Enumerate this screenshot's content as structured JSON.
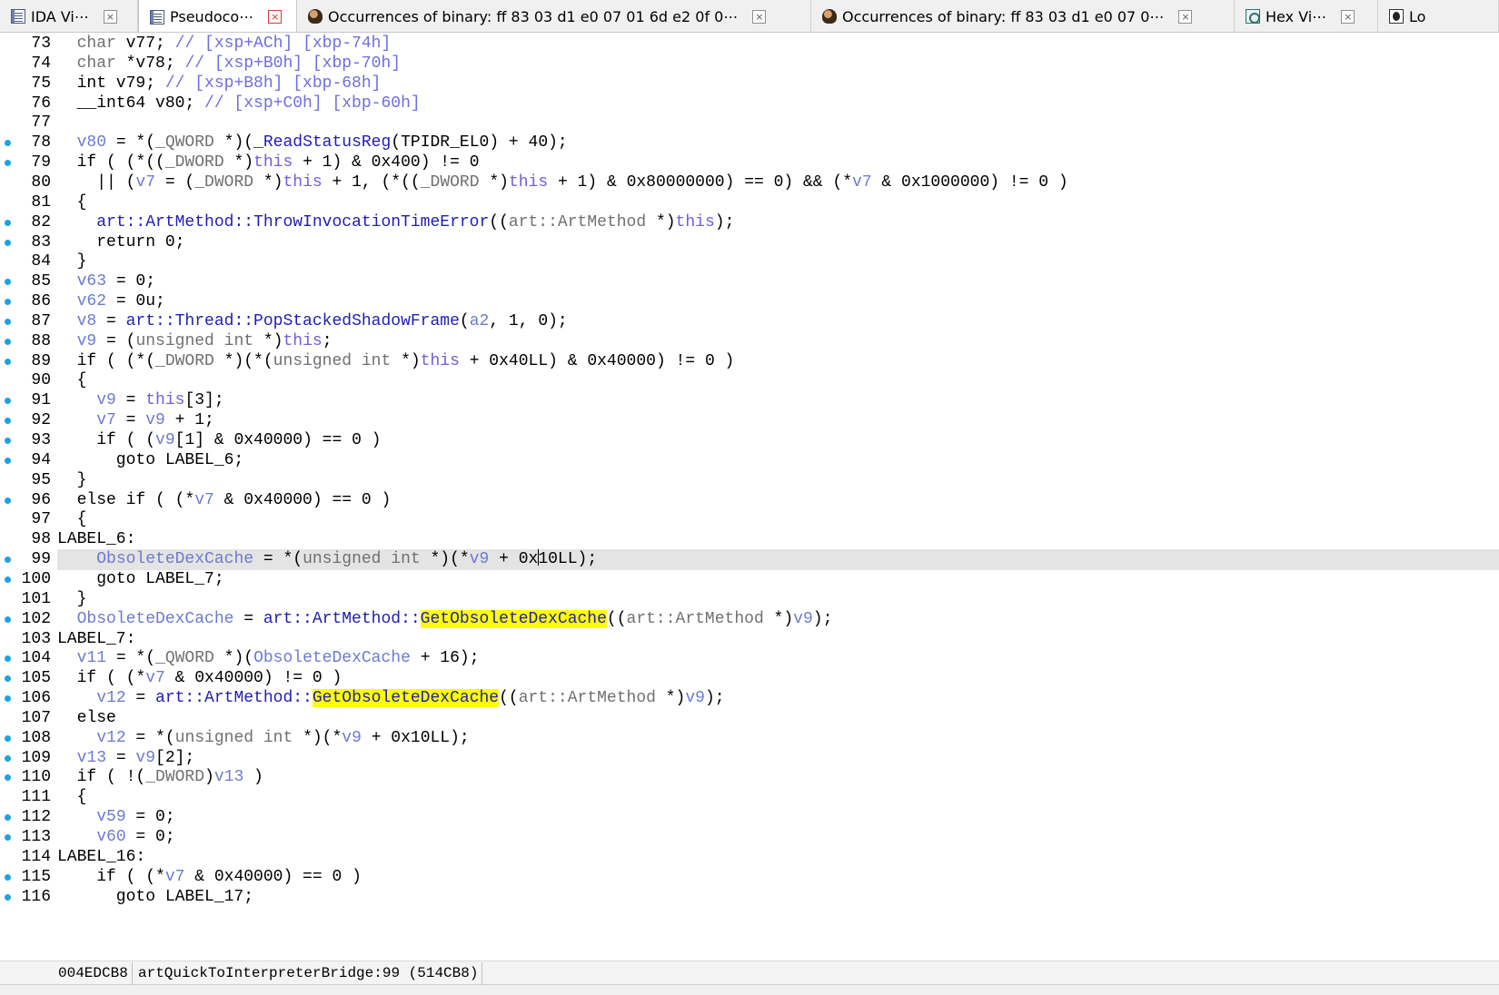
{
  "tabs": [
    {
      "label": "IDA Vi⋯",
      "icon": "disassembly-view-icon",
      "active": false
    },
    {
      "label": "Pseudoco⋯",
      "icon": "pseudocode-view-icon",
      "active": true
    },
    {
      "label": "Occurrences of binary: ff 83 03 d1 e0 07 01 6d e2 0f 0⋯",
      "icon": "occurrences-icon",
      "active": false
    },
    {
      "label": "Occurrences of binary: ff 83 03 d1 e0 07 0⋯",
      "icon": "occurrences-icon",
      "active": false
    },
    {
      "label": "Hex Vi⋯",
      "icon": "hex-view-icon",
      "active": false
    },
    {
      "label": "Lo",
      "icon": "log-icon",
      "active": false
    }
  ],
  "tab_close_glyph": "×",
  "colors": {
    "bullet": "#1aa3e0",
    "highlight": "#ffff00",
    "current_line": "#e4e4e4",
    "comment": "#6e6ee0",
    "variable": "#6b7bd0",
    "function": "#2020b0"
  },
  "lines": [
    {
      "n": "73",
      "bp": false,
      "tokens": [
        [
          "",
          "  "
        ],
        [
          "type",
          "char"
        ],
        [
          "",
          " v77; "
        ],
        [
          "comment",
          "// [xsp+ACh] [xbp-74h]"
        ]
      ]
    },
    {
      "n": "74",
      "bp": false,
      "tokens": [
        [
          "",
          "  "
        ],
        [
          "type",
          "char"
        ],
        [
          "",
          " *v78; "
        ],
        [
          "comment",
          "// [xsp+B0h] [xbp-70h]"
        ]
      ]
    },
    {
      "n": "75",
      "bp": false,
      "tokens": [
        [
          "",
          "  int v79; "
        ],
        [
          "comment",
          "// [xsp+B8h] [xbp-68h]"
        ]
      ]
    },
    {
      "n": "76",
      "bp": false,
      "tokens": [
        [
          "",
          "  __int64 v80; "
        ],
        [
          "comment",
          "// [xsp+C0h] [xbp-60h]"
        ]
      ]
    },
    {
      "n": "77",
      "bp": false,
      "tokens": []
    },
    {
      "n": "78",
      "bp": true,
      "tokens": [
        [
          "",
          "  "
        ],
        [
          "var",
          "v80"
        ],
        [
          "",
          " = *("
        ],
        [
          "type",
          "_QWORD"
        ],
        [
          "",
          " *)("
        ],
        [
          "func",
          "_ReadStatusReg"
        ],
        [
          "",
          "(TPIDR_EL0) + 40);"
        ]
      ]
    },
    {
      "n": "79",
      "bp": true,
      "tokens": [
        [
          "",
          "  if ( (*(("
        ],
        [
          "type",
          "_DWORD"
        ],
        [
          "",
          " *)"
        ],
        [
          "this",
          "this"
        ],
        [
          "",
          " + 1) & 0x400) != 0"
        ]
      ]
    },
    {
      "n": "80",
      "bp": false,
      "tokens": [
        [
          "",
          "    || ("
        ],
        [
          "var",
          "v7"
        ],
        [
          "",
          " = ("
        ],
        [
          "type",
          "_DWORD"
        ],
        [
          "",
          " *)"
        ],
        [
          "this",
          "this"
        ],
        [
          "",
          " + 1, (*(("
        ],
        [
          "type",
          "_DWORD"
        ],
        [
          "",
          " *)"
        ],
        [
          "this",
          "this"
        ],
        [
          "",
          " + 1) & 0x80000000) == 0) && (*"
        ],
        [
          "var",
          "v7"
        ],
        [
          "",
          " & 0x1000000) != 0 )"
        ]
      ]
    },
    {
      "n": "81",
      "bp": false,
      "tokens": [
        [
          "",
          "  {"
        ]
      ]
    },
    {
      "n": "82",
      "bp": true,
      "tokens": [
        [
          "",
          "    "
        ],
        [
          "func",
          "art::ArtMethod::ThrowInvocationTimeError"
        ],
        [
          "",
          "(("
        ],
        [
          "type",
          "art::ArtMethod"
        ],
        [
          "",
          " *)"
        ],
        [
          "this",
          "this"
        ],
        [
          "",
          ");"
        ]
      ]
    },
    {
      "n": "83",
      "bp": true,
      "tokens": [
        [
          "",
          "    return 0;"
        ]
      ]
    },
    {
      "n": "84",
      "bp": false,
      "tokens": [
        [
          "",
          "  }"
        ]
      ]
    },
    {
      "n": "85",
      "bp": true,
      "tokens": [
        [
          "",
          "  "
        ],
        [
          "var",
          "v63"
        ],
        [
          "",
          " = 0;"
        ]
      ]
    },
    {
      "n": "86",
      "bp": true,
      "tokens": [
        [
          "",
          "  "
        ],
        [
          "var",
          "v62"
        ],
        [
          "",
          " = 0u;"
        ]
      ]
    },
    {
      "n": "87",
      "bp": true,
      "tokens": [
        [
          "",
          "  "
        ],
        [
          "var",
          "v8"
        ],
        [
          "",
          " = "
        ],
        [
          "func",
          "art::Thread::PopStackedShadowFrame"
        ],
        [
          "",
          "("
        ],
        [
          "var",
          "a2"
        ],
        [
          "",
          ", 1, 0);"
        ]
      ]
    },
    {
      "n": "88",
      "bp": true,
      "tokens": [
        [
          "",
          "  "
        ],
        [
          "var",
          "v9"
        ],
        [
          "",
          " = ("
        ],
        [
          "type",
          "unsigned int"
        ],
        [
          "",
          " *)"
        ],
        [
          "this",
          "this"
        ],
        [
          "",
          ";"
        ]
      ]
    },
    {
      "n": "89",
      "bp": true,
      "tokens": [
        [
          "",
          "  if ( (*("
        ],
        [
          "type",
          "_DWORD"
        ],
        [
          "",
          " *)(*("
        ],
        [
          "type",
          "unsigned int"
        ],
        [
          "",
          " *)"
        ],
        [
          "this",
          "this"
        ],
        [
          "",
          " + 0x40LL) & 0x40000) != 0 )"
        ]
      ]
    },
    {
      "n": "90",
      "bp": false,
      "tokens": [
        [
          "",
          "  {"
        ]
      ]
    },
    {
      "n": "91",
      "bp": true,
      "tokens": [
        [
          "",
          "    "
        ],
        [
          "var",
          "v9"
        ],
        [
          "",
          " = "
        ],
        [
          "this",
          "this"
        ],
        [
          "",
          "[3];"
        ]
      ]
    },
    {
      "n": "92",
      "bp": true,
      "tokens": [
        [
          "",
          "    "
        ],
        [
          "var",
          "v7"
        ],
        [
          "",
          " = "
        ],
        [
          "var",
          "v9"
        ],
        [
          "",
          " + 1;"
        ]
      ]
    },
    {
      "n": "93",
      "bp": true,
      "tokens": [
        [
          "",
          "    if ( ("
        ],
        [
          "var",
          "v9"
        ],
        [
          "",
          "[1] & 0x40000) == 0 )"
        ]
      ]
    },
    {
      "n": "94",
      "bp": true,
      "tokens": [
        [
          "",
          "      goto LABEL_6;"
        ]
      ]
    },
    {
      "n": "95",
      "bp": false,
      "tokens": [
        [
          "",
          "  }"
        ]
      ]
    },
    {
      "n": "96",
      "bp": true,
      "tokens": [
        [
          "",
          "  else if ( (*"
        ],
        [
          "var",
          "v7"
        ],
        [
          "",
          " & 0x40000) == 0 )"
        ]
      ]
    },
    {
      "n": "97",
      "bp": false,
      "tokens": [
        [
          "",
          "  {"
        ]
      ]
    },
    {
      "n": "98",
      "bp": false,
      "tokens": [
        [
          "",
          "LABEL_6:"
        ]
      ]
    },
    {
      "n": "99",
      "bp": true,
      "current": true,
      "tokens": [
        [
          "",
          "    "
        ],
        [
          "glob",
          "ObsoleteDexCache"
        ],
        [
          "",
          " = *("
        ],
        [
          "type",
          "unsigned int"
        ],
        [
          "",
          " *)(*"
        ],
        [
          "var",
          "v9"
        ],
        [
          "",
          " + 0x"
        ],
        [
          "caret",
          ""
        ],
        [
          "",
          "10LL);"
        ]
      ]
    },
    {
      "n": "100",
      "bp": true,
      "tokens": [
        [
          "",
          "    goto LABEL_7;"
        ]
      ]
    },
    {
      "n": "101",
      "bp": false,
      "tokens": [
        [
          "",
          "  }"
        ]
      ]
    },
    {
      "n": "102",
      "bp": true,
      "tokens": [
        [
          "",
          "  "
        ],
        [
          "glob",
          "ObsoleteDexCache"
        ],
        [
          "",
          " = "
        ],
        [
          "func",
          "art::ArtMethod::"
        ],
        [
          "hl",
          "GetObsoleteDexCache"
        ],
        [
          "",
          "(("
        ],
        [
          "type",
          "art::ArtMethod"
        ],
        [
          "",
          " *)"
        ],
        [
          "var",
          "v9"
        ],
        [
          "",
          ");"
        ]
      ]
    },
    {
      "n": "103",
      "bp": false,
      "tokens": [
        [
          "",
          "LABEL_7:"
        ]
      ]
    },
    {
      "n": "104",
      "bp": true,
      "tokens": [
        [
          "",
          "  "
        ],
        [
          "var",
          "v11"
        ],
        [
          "",
          " = *("
        ],
        [
          "type",
          "_QWORD"
        ],
        [
          "",
          " *)("
        ],
        [
          "glob",
          "ObsoleteDexCache"
        ],
        [
          "",
          " + 16);"
        ]
      ]
    },
    {
      "n": "105",
      "bp": true,
      "tokens": [
        [
          "",
          "  if ( (*"
        ],
        [
          "var",
          "v7"
        ],
        [
          "",
          " & 0x40000) != 0 )"
        ]
      ]
    },
    {
      "n": "106",
      "bp": true,
      "tokens": [
        [
          "",
          "    "
        ],
        [
          "var",
          "v12"
        ],
        [
          "",
          " = "
        ],
        [
          "func",
          "art::ArtMethod::"
        ],
        [
          "hl",
          "GetObsoleteDexCache"
        ],
        [
          "",
          "(("
        ],
        [
          "type",
          "art::ArtMethod"
        ],
        [
          "",
          " *)"
        ],
        [
          "var",
          "v9"
        ],
        [
          "",
          ");"
        ]
      ]
    },
    {
      "n": "107",
      "bp": false,
      "tokens": [
        [
          "",
          "  else"
        ]
      ]
    },
    {
      "n": "108",
      "bp": true,
      "tokens": [
        [
          "",
          "    "
        ],
        [
          "var",
          "v12"
        ],
        [
          "",
          " = *("
        ],
        [
          "type",
          "unsigned int"
        ],
        [
          "",
          " *)(*"
        ],
        [
          "var",
          "v9"
        ],
        [
          "",
          " + 0x10LL);"
        ]
      ]
    },
    {
      "n": "109",
      "bp": true,
      "tokens": [
        [
          "",
          "  "
        ],
        [
          "var",
          "v13"
        ],
        [
          "",
          " = "
        ],
        [
          "var",
          "v9"
        ],
        [
          "",
          "[2];"
        ]
      ]
    },
    {
      "n": "110",
      "bp": true,
      "tokens": [
        [
          "",
          "  if ( !("
        ],
        [
          "type",
          "_DWORD"
        ],
        [
          "",
          ")"
        ],
        [
          "var",
          "v13"
        ],
        [
          "",
          " )"
        ]
      ]
    },
    {
      "n": "111",
      "bp": false,
      "tokens": [
        [
          "",
          "  {"
        ]
      ]
    },
    {
      "n": "112",
      "bp": true,
      "tokens": [
        [
          "",
          "    "
        ],
        [
          "var",
          "v59"
        ],
        [
          "",
          " = 0;"
        ]
      ]
    },
    {
      "n": "113",
      "bp": true,
      "tokens": [
        [
          "",
          "    "
        ],
        [
          "var",
          "v60"
        ],
        [
          "",
          " = 0;"
        ]
      ]
    },
    {
      "n": "114",
      "bp": false,
      "tokens": [
        [
          "",
          "LABEL_16:"
        ]
      ]
    },
    {
      "n": "115",
      "bp": true,
      "tokens": [
        [
          "",
          "    if ( (*"
        ],
        [
          "var",
          "v7"
        ],
        [
          "",
          " & 0x40000) == 0 )"
        ]
      ]
    },
    {
      "n": "116",
      "bp": true,
      "tokens": [
        [
          "",
          "      goto LABEL_17;"
        ]
      ]
    }
  ],
  "status": {
    "address": "004EDCB8",
    "location": "artQuickToInterpreterBridge:99 (514CB8)"
  }
}
